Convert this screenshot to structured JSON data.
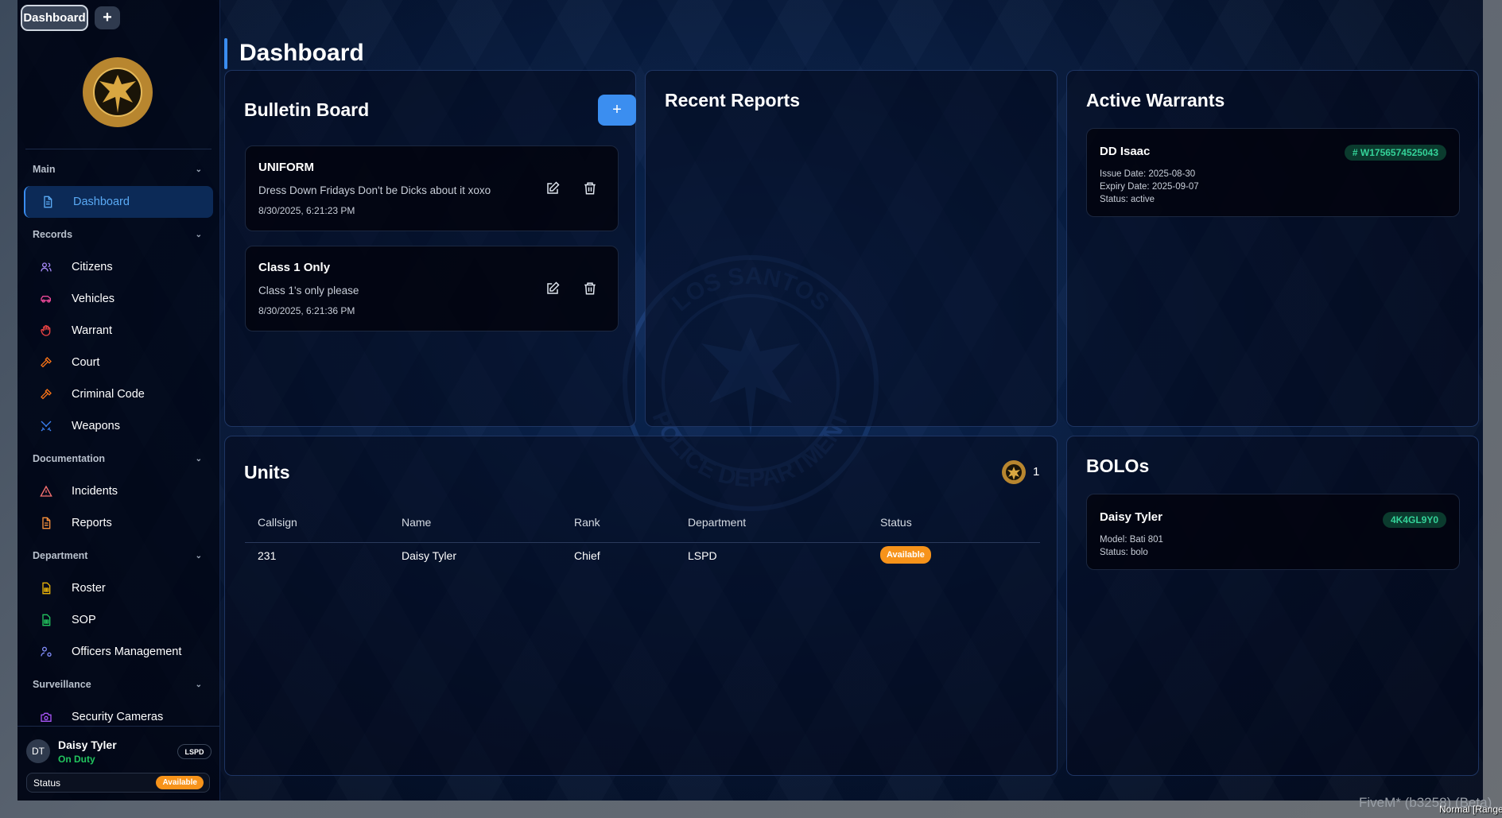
{
  "tabs": {
    "active": "Dashboard",
    "add": "+"
  },
  "logo_text": "LOS SANTOS POLICE DEPARTMENT",
  "sidebar": {
    "sections": [
      {
        "label": "Main",
        "items": [
          {
            "label": "Dashboard",
            "icon": "document-icon",
            "color": "#5aaaf5",
            "active": true
          }
        ]
      },
      {
        "label": "Records",
        "items": [
          {
            "label": "Citizens",
            "icon": "users-icon",
            "color": "#a78bfa"
          },
          {
            "label": "Vehicles",
            "icon": "car-icon",
            "color": "#ec4899"
          },
          {
            "label": "Warrant",
            "icon": "hand-icon",
            "color": "#ef4444"
          },
          {
            "label": "Court",
            "icon": "gavel-icon",
            "color": "#f97316"
          },
          {
            "label": "Criminal Code",
            "icon": "gavel-icon",
            "color": "#f97316"
          },
          {
            "label": "Weapons",
            "icon": "swords-icon",
            "color": "#3b82f6"
          }
        ]
      },
      {
        "label": "Documentation",
        "items": [
          {
            "label": "Incidents",
            "icon": "warning-icon",
            "color": "#f87171"
          },
          {
            "label": "Reports",
            "icon": "document-icon",
            "color": "#fb923c"
          }
        ]
      },
      {
        "label": "Department",
        "items": [
          {
            "label": "Roster",
            "icon": "sheet-icon",
            "color": "#eab308"
          },
          {
            "label": "SOP",
            "icon": "sheet-icon",
            "color": "#22c55e"
          },
          {
            "label": "Officers Management",
            "icon": "user-cog-icon",
            "color": "#818cf8"
          }
        ]
      },
      {
        "label": "Surveillance",
        "items": [
          {
            "label": "Security Cameras",
            "icon": "camera-icon",
            "color": "#a855f7"
          }
        ]
      }
    ],
    "user": {
      "initials": "DT",
      "name": "Daisy Tyler",
      "duty": "On Duty",
      "dept": "LSPD",
      "status_label": "Status",
      "status": "Available"
    }
  },
  "page_title": "Dashboard",
  "bulletin": {
    "title": "Bulletin Board",
    "add": "+",
    "posts": [
      {
        "title": "UNIFORM",
        "body": "Dress Down Fridays Don't be Dicks about it xoxo",
        "date": "8/30/2025, 6:21:23 PM"
      },
      {
        "title": "Class 1 Only",
        "body": "Class 1's only please",
        "date": "8/30/2025, 6:21:36 PM"
      }
    ]
  },
  "reports": {
    "title": "Recent Reports"
  },
  "warrants": {
    "title": "Active Warrants",
    "items": [
      {
        "name": "DD Isaac",
        "id": "# W1756574525043",
        "issue": "Issue Date: 2025-08-30",
        "expiry": "Expiry Date: 2025-09-07",
        "status": "Status: active"
      }
    ]
  },
  "units": {
    "title": "Units",
    "count": "1",
    "columns": [
      "Callsign",
      "Name",
      "Rank",
      "Department",
      "Status"
    ],
    "rows": [
      {
        "callsign": "231",
        "name": "Daisy Tyler",
        "rank": "Chief",
        "department": "LSPD",
        "status": "Available"
      }
    ]
  },
  "bolos": {
    "title": "BOLOs",
    "items": [
      {
        "name": "Daisy Tyler",
        "plate": "4K4GL9Y0",
        "model": "Model: Bati 801",
        "status": "Status: bolo"
      }
    ]
  },
  "overlay": {
    "fivem": "FiveM* (b3258) (Beta)",
    "mode": "Normal [Range]"
  }
}
